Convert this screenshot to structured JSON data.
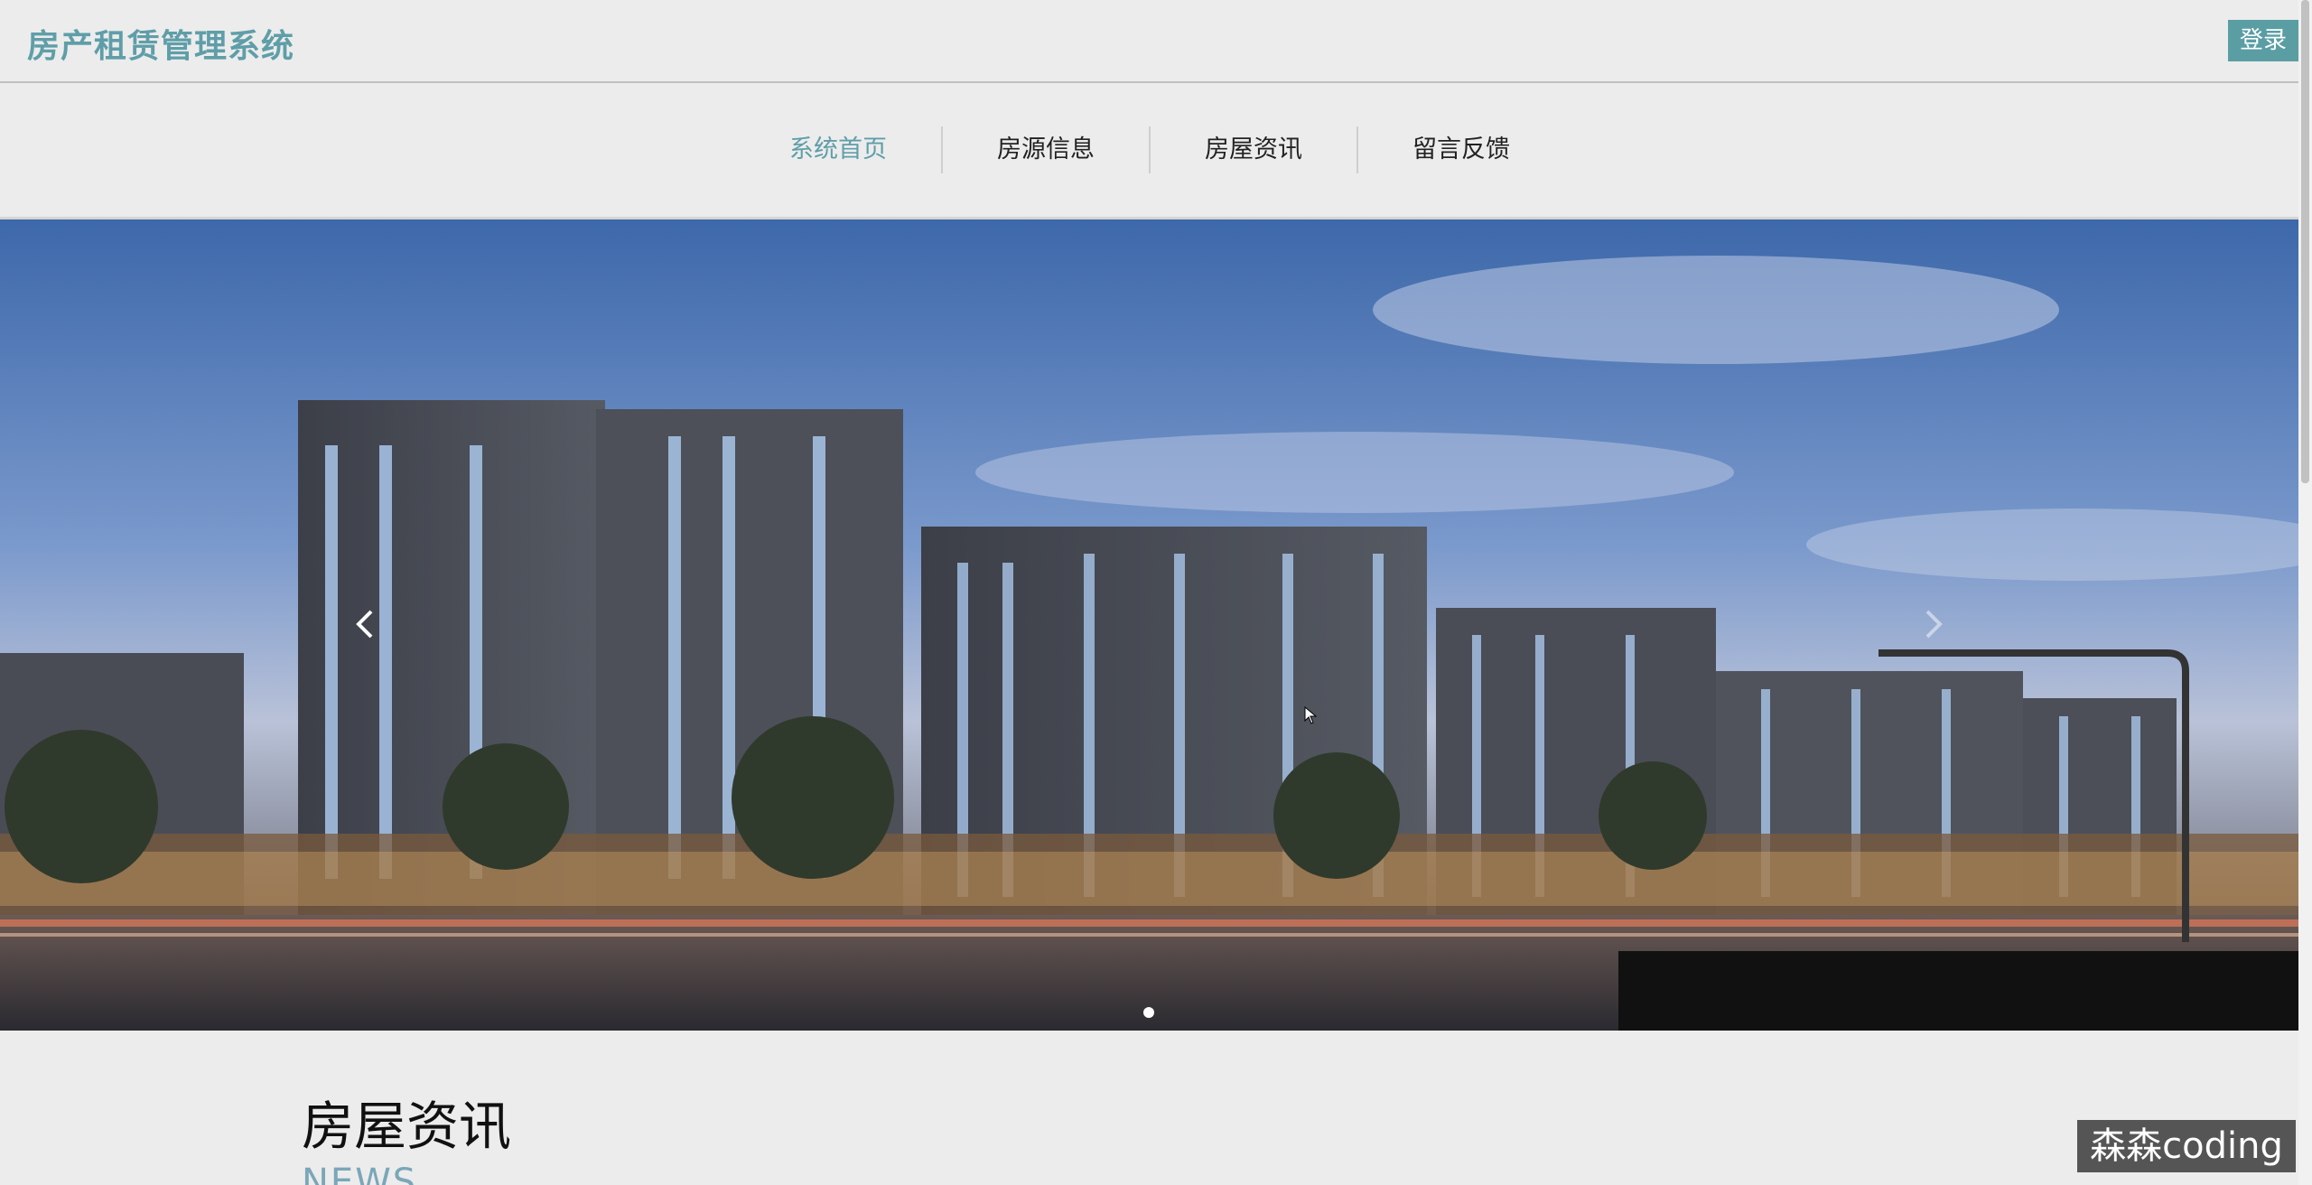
{
  "header": {
    "brand": "房产租赁管理系统",
    "login_label": "登录"
  },
  "nav": {
    "items": [
      {
        "label": "系统首页",
        "active": true
      },
      {
        "label": "房源信息",
        "active": false
      },
      {
        "label": "房屋资讯",
        "active": false
      },
      {
        "label": "留言反馈",
        "active": false
      }
    ]
  },
  "banner": {
    "slide_count": 1,
    "active_slide": 1
  },
  "news": {
    "title": "房屋资讯",
    "subtitle": "NEWS"
  },
  "watermark": "森森coding",
  "colors": {
    "accent": "#5f9ea8",
    "login_bg": "#5a9ea4"
  }
}
